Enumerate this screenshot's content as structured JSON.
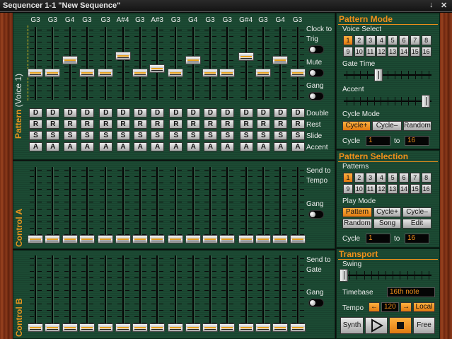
{
  "window": {
    "title": "Sequencer 1-1 \"New Sequence\"",
    "controls": {
      "minimize": "↓",
      "close": "✕"
    }
  },
  "pattern": {
    "label": "Pattern",
    "voice_label": "(Voice 1)",
    "notes": [
      "G3",
      "G3",
      "G4",
      "G3",
      "G3",
      "A#4",
      "G3",
      "A#3",
      "G3",
      "G4",
      "G3",
      "G3",
      "G#4",
      "G3",
      "G4",
      "G3"
    ],
    "slider_levels": [
      0.35,
      0.35,
      0.55,
      0.35,
      0.35,
      0.62,
      0.35,
      0.42,
      0.35,
      0.55,
      0.35,
      0.35,
      0.6,
      0.35,
      0.55,
      0.35
    ],
    "step_buttons": {
      "double": "D",
      "rest": "R",
      "slide": "S",
      "accent": "A"
    },
    "right_labels": {
      "clock_to": "Clock to",
      "trig": "Trig",
      "mute": "Mute",
      "gang": "Gang",
      "double": "Double",
      "rest": "Rest",
      "slide": "Slide",
      "accent": "Accent"
    }
  },
  "control_a": {
    "label": "Control A",
    "send_to": "Send to",
    "target": "Tempo",
    "gang": "Gang",
    "slider_levels": [
      0,
      0,
      0,
      0,
      0,
      0,
      0,
      0,
      0,
      0,
      0,
      0,
      0,
      0,
      0,
      0
    ]
  },
  "control_b": {
    "label": "Control B",
    "send_to": "Send to",
    "target": "Gate",
    "gang": "Gang",
    "slider_levels": [
      0,
      0,
      0,
      0,
      0,
      0,
      0,
      0,
      0,
      0,
      0,
      0,
      0,
      0,
      0,
      0
    ]
  },
  "pattern_mode": {
    "title": "Pattern Mode",
    "voice_select_label": "Voice Select",
    "voices": [
      "1",
      "2",
      "3",
      "4",
      "5",
      "6",
      "7",
      "8",
      "9",
      "10",
      "11",
      "12",
      "13",
      "14",
      "15",
      "16"
    ],
    "voice_selected": "1",
    "gate_time_label": "Gate Time",
    "gate_time_level": 0.38,
    "accent_label": "Accent",
    "accent_level": 0.98,
    "cycle_mode_label": "Cycle Mode",
    "cycle_modes": [
      "Cycle+",
      "Cycle–",
      "Random"
    ],
    "cycle_mode_selected": "Cycle+",
    "cycle_label": "Cycle",
    "cycle_from": "1",
    "to_label": "to",
    "cycle_to": "16"
  },
  "pattern_selection": {
    "title": "Pattern Selection",
    "patterns_label": "Patterns",
    "patterns": [
      "1",
      "2",
      "3",
      "4",
      "5",
      "6",
      "7",
      "8",
      "9",
      "10",
      "11",
      "12",
      "13",
      "14",
      "15",
      "16"
    ],
    "pattern_selected": "1",
    "play_mode_label": "Play Mode",
    "play_modes": [
      "Pattern",
      "Cycle+",
      "Cycle–",
      "Random",
      "Song",
      "Edit"
    ],
    "play_mode_selected": "Pattern",
    "cycle_label": "Cycle",
    "cycle_from": "1",
    "to_label": "to",
    "cycle_to": "16"
  },
  "transport": {
    "title": "Transport",
    "swing_label": "Swing",
    "swing_level": 0.0,
    "timebase_label": "Timebase",
    "timebase_value": "16th note",
    "tempo_label": "Tempo",
    "tempo_left_arrow": "←",
    "tempo_value": "120",
    "tempo_right_arrow": "→",
    "tempo_source": "Local",
    "synth_label": "Synth",
    "play_icon": "play-icon",
    "stop_icon": "stop-icon",
    "free_label": "Free"
  }
}
